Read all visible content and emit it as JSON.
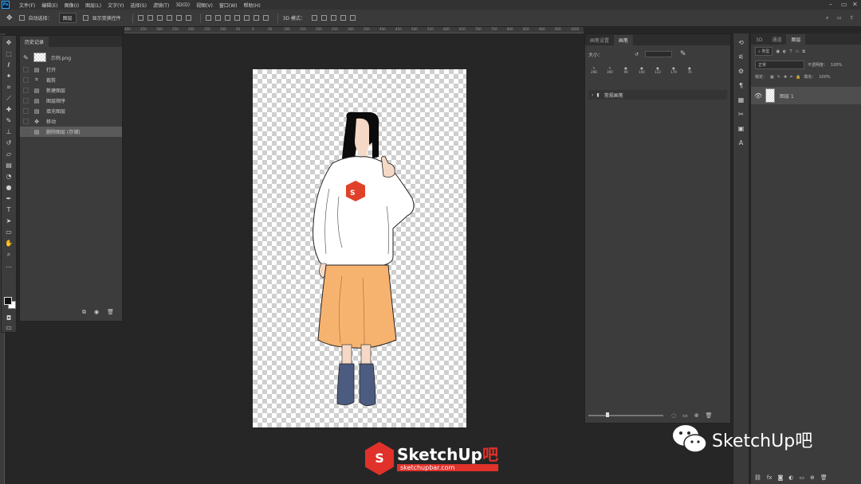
{
  "app": {
    "logo": "Ps"
  },
  "menu": [
    "文件(F)",
    "编辑(E)",
    "图像(I)",
    "图层(L)",
    "文字(Y)",
    "选择(S)",
    "滤镜(T)",
    "3D(D)",
    "视图(V)",
    "窗口(W)",
    "帮助(H)"
  ],
  "options": {
    "auto_select_label": "自动选择：",
    "auto_select_value": "图层",
    "show_transform_label": "显示变换控件",
    "mode_3d": "3D 模式："
  },
  "ruler_ticks": [
    "400",
    "350",
    "300",
    "250",
    "200",
    "150",
    "100",
    "50",
    "0",
    "50",
    "100",
    "150",
    "200",
    "250",
    "300",
    "350",
    "400",
    "450",
    "500",
    "550",
    "600",
    "650",
    "700",
    "750",
    "800",
    "850",
    "900",
    "950",
    "1000"
  ],
  "history": {
    "tab": "历史记录",
    "snapshot": "示例.png",
    "items": [
      {
        "icon": "doc-icon",
        "label": "打开"
      },
      {
        "icon": "crop-icon",
        "label": "裁剪"
      },
      {
        "icon": "doc-icon",
        "label": "新建图层"
      },
      {
        "icon": "doc-icon",
        "label": "图层顺序"
      },
      {
        "icon": "doc-icon",
        "label": "填充图层"
      },
      {
        "icon": "move-icon",
        "label": "移动"
      },
      {
        "icon": "doc-icon",
        "label": "删除图层 (存储)"
      }
    ]
  },
  "brush_panel": {
    "tabs": [
      "画笔设置",
      "画笔"
    ],
    "size_label": "大小：",
    "tips": [
      "298",
      "300",
      "90",
      "100",
      "123",
      "179",
      "70"
    ],
    "folder": "常规画笔"
  },
  "layers_panel": {
    "tabs": [
      "3D",
      "通道",
      "图层"
    ],
    "filter": "类型",
    "blend_mode": "正常",
    "opacity_label": "不透明度：",
    "opacity": "100%",
    "lock_label": "锁定：",
    "fill_label": "填充：",
    "fill": "100%",
    "layer_name": "图层 1"
  },
  "watermarks": {
    "wechat": "SketchUp吧",
    "brand_a": "SketchUp",
    "brand_b": "吧",
    "url": "sketchupbar.com"
  },
  "colors": {
    "accent": "#31a8ff",
    "brand_red": "#e0312b",
    "skirt": "#f6b36f",
    "boots": "#4c5b80",
    "logo_red": "#e0412a"
  }
}
